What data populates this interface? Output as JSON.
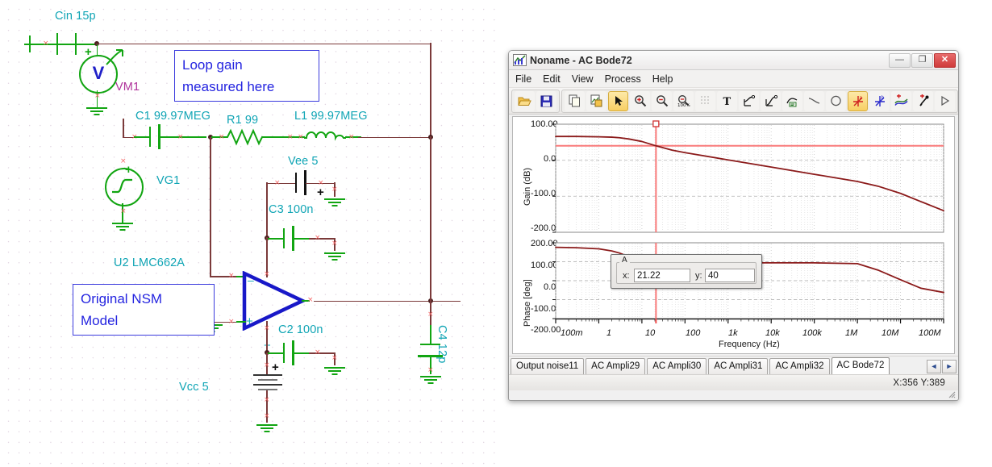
{
  "schematic": {
    "components": [
      {
        "id": "cin",
        "label": "Cin 15p"
      },
      {
        "id": "vm1",
        "label": "VM1",
        "symbol": "V"
      },
      {
        "id": "c1",
        "label": "C1 99.97MEG"
      },
      {
        "id": "r1",
        "label": "R1 99"
      },
      {
        "id": "l1",
        "label": "L1 99.97MEG"
      },
      {
        "id": "vg1",
        "label": "VG1"
      },
      {
        "id": "vee",
        "label": "Vee 5"
      },
      {
        "id": "c3",
        "label": "C3 100n"
      },
      {
        "id": "u2",
        "label": "U2 LMC662A"
      },
      {
        "id": "c2",
        "label": "C2 100n"
      },
      {
        "id": "vcc",
        "label": "Vcc 5"
      },
      {
        "id": "c4",
        "label": "C4 12p"
      }
    ],
    "notes": [
      {
        "id": "loop-gain-note",
        "text": "Loop gain\nmeasured here"
      },
      {
        "id": "model-note",
        "text": "Original NSM\nModel"
      }
    ],
    "opamp_pins": {
      "minus": "–",
      "plus_sym": "+",
      "plus_in": "+"
    },
    "colors": {
      "label": "#10a5b5",
      "note_text": "#2424e0",
      "note_border": "#3b3bdd",
      "wire": "#7b3a3a",
      "green": "#12a512",
      "vm_label": "#b0339b"
    }
  },
  "window": {
    "title": "Noname - AC Bode72",
    "icon": "plot-window-icon",
    "buttons": {
      "minimize": "—",
      "maximize": "❐",
      "close": "✕"
    },
    "menu": [
      "File",
      "Edit",
      "View",
      "Process",
      "Help"
    ],
    "toolbar": [
      {
        "name": "open-icon",
        "active": false
      },
      {
        "name": "save-icon",
        "active": false
      },
      {
        "name": "copy-icon",
        "active": false
      },
      {
        "name": "paste-image-icon",
        "active": false
      },
      {
        "name": "select-arrow-icon",
        "active": true
      },
      {
        "name": "zoom-in-icon",
        "active": false
      },
      {
        "name": "zoom-out-icon",
        "active": false
      },
      {
        "name": "zoom-100-icon",
        "active": false
      },
      {
        "name": "grid-icon",
        "active": false
      },
      {
        "name": "text-tool-icon",
        "active": false
      },
      {
        "name": "curve-tool-1-icon",
        "active": false
      },
      {
        "name": "curve-tool-2-icon",
        "active": false
      },
      {
        "name": "curve-label-icon",
        "active": false
      },
      {
        "name": "line-tool-icon",
        "active": false
      },
      {
        "name": "ellipse-tool-icon",
        "active": false
      },
      {
        "name": "cursor-a-icon",
        "active": true
      },
      {
        "name": "cursor-b-icon",
        "active": false
      },
      {
        "name": "add-curve-icon",
        "active": false
      },
      {
        "name": "pick-color-icon",
        "active": false
      },
      {
        "name": "run-icon",
        "active": false
      }
    ],
    "cursor_box": {
      "group_label": "A",
      "x_label": "x:",
      "x_value": "21.22",
      "y_label": "y:",
      "y_value": "40"
    },
    "tabs": [
      {
        "label": "Output noise11",
        "active": false
      },
      {
        "label": "AC Ampli29",
        "active": false
      },
      {
        "label": "AC Ampli30",
        "active": false
      },
      {
        "label": "AC Ampli31",
        "active": false
      },
      {
        "label": "AC Ampli32",
        "active": false
      },
      {
        "label": "AC Bode72",
        "active": true
      }
    ],
    "tab_nav": {
      "prev": "◄",
      "next": "►"
    },
    "status": {
      "coords": "X:356  Y:389"
    }
  },
  "chart_data": [
    {
      "type": "line",
      "title": "",
      "ylabel": "Gain (dB)",
      "xlabel": "",
      "xscale": "log",
      "xlim": [
        0.1,
        100000000
      ],
      "ylim": [
        -200,
        100
      ],
      "yticks": [
        "100.00",
        "0.00",
        "-100.00",
        "-200.00"
      ],
      "ytickvals": [
        100,
        0,
        -100,
        -200
      ],
      "grid": true,
      "series": [
        {
          "name": "Gain",
          "color": "#8b1a1a",
          "x": [
            0.1,
            0.3,
            1,
            2,
            3,
            5,
            10,
            21.22,
            50,
            100,
            1000,
            10000,
            100000,
            1000000,
            3000000,
            10000000,
            30000000,
            100000000
          ],
          "y": [
            66,
            66,
            65,
            64,
            62.5,
            59,
            52,
            40,
            28,
            21,
            1,
            -19,
            -39,
            -59,
            -72,
            -92,
            -115,
            -140
          ]
        }
      ],
      "markers": [
        {
          "name": "cursor-a-vertical",
          "type": "vline",
          "x": 21.22,
          "color": "#f97b7b"
        },
        {
          "name": "cursor-a-horizontal",
          "type": "hline",
          "y": 40,
          "color": "#f97b7b"
        }
      ]
    },
    {
      "type": "line",
      "title": "",
      "ylabel": "Phase [deg]",
      "xlabel": "Frequency (Hz)",
      "xscale": "log",
      "xlim": [
        0.1,
        100000000
      ],
      "ylim": [
        -200,
        200
      ],
      "yticks": [
        "200.00",
        "100.00",
        "0.00",
        "-100.00",
        "-200.00"
      ],
      "ytickvals": [
        200,
        100,
        0,
        -100,
        -200
      ],
      "xticks": [
        "100m",
        "1",
        "10",
        "100",
        "1k",
        "10k",
        "100k",
        "1M",
        "10M",
        "100M"
      ],
      "xtickvals": [
        0.1,
        1,
        10,
        100,
        1000,
        10000,
        100000,
        1000000,
        10000000,
        100000000
      ],
      "grid": true,
      "series": [
        {
          "name": "Phase",
          "color": "#8b1a1a",
          "x": [
            0.1,
            0.3,
            1,
            2,
            3,
            5,
            10,
            21.22,
            100,
            1000,
            10000,
            100000,
            1000000,
            3000000,
            10000000,
            30000000,
            100000000
          ],
          "y": [
            176,
            174,
            168,
            157,
            146,
            127,
            105,
            97,
            94,
            94,
            94,
            94,
            90,
            56,
            5,
            -40,
            -62
          ]
        }
      ],
      "markers": [
        {
          "name": "cursor-a-vertical",
          "type": "vline",
          "x": 21.22,
          "color": "#f97b7b"
        }
      ]
    }
  ]
}
